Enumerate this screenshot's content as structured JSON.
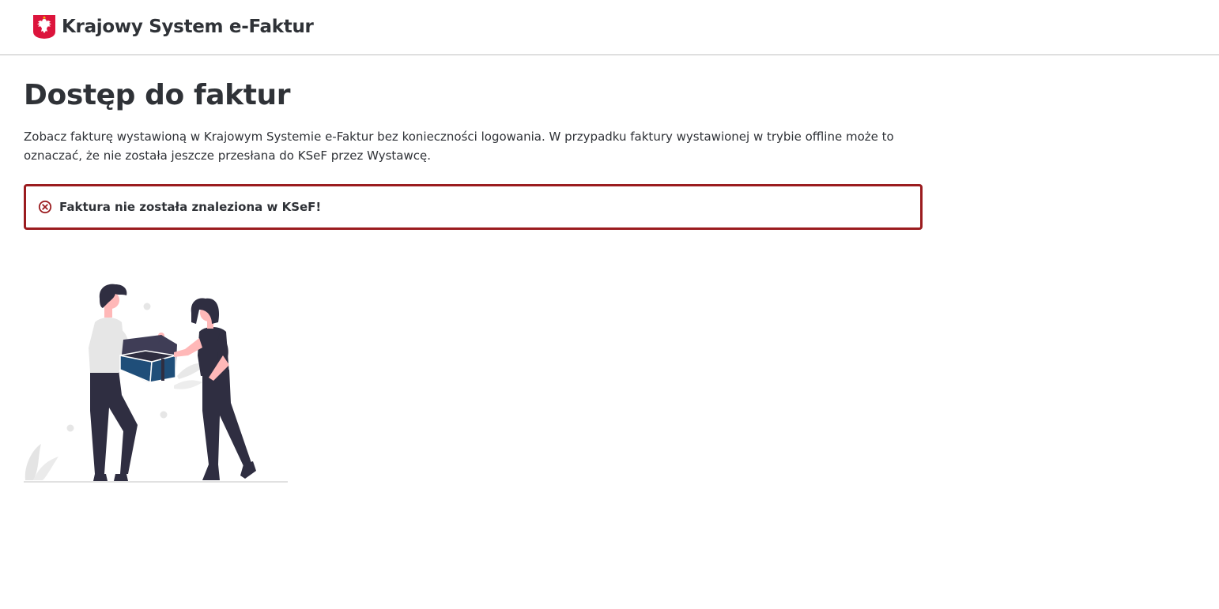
{
  "header": {
    "app_title": "Krajowy System e-Faktur",
    "emblem_icon": "polish-eagle-emblem-icon"
  },
  "main": {
    "page_title": "Dostęp do faktur",
    "description": "Zobacz fakturę wystawioną w Krajowym Systemie e-Faktur bez konieczności logowania. W przypadku faktury wystawionej w trybie offline może to oznaczać, że nie została jeszcze przesłana do KSeF przez Wystawcę.",
    "alert": {
      "icon": "error-circle-x-icon",
      "message": "Faktura nie została znaleziona w KSeF!",
      "border_color": "#9b1c1f"
    },
    "illustration": "two-people-handing-box-illustration"
  },
  "colors": {
    "text": "#2f3237",
    "emblem_red": "#dc143c",
    "error_red": "#9b1c1f",
    "box_blue": "#1f4e79"
  }
}
